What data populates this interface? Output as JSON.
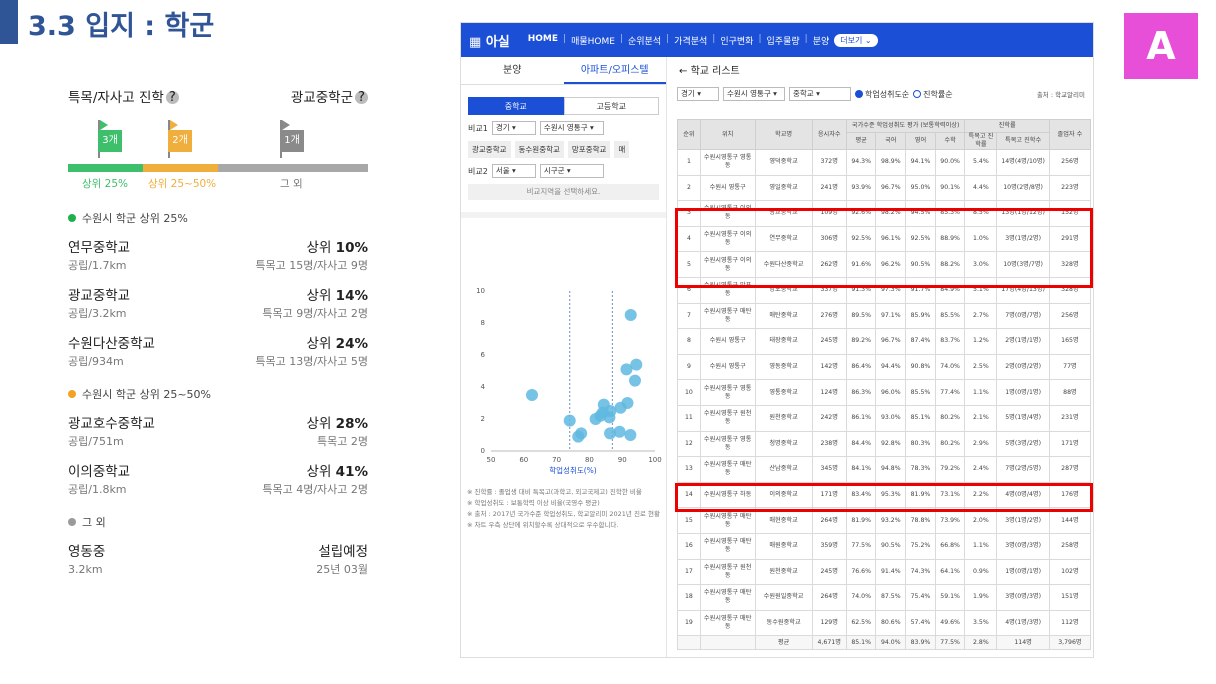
{
  "title": "3.3 입지 : 학군",
  "badge": "A",
  "left": {
    "header_left": "특목/자사고 진학",
    "header_right": "광교중학군",
    "help": "?",
    "flags": [
      {
        "label": "3개",
        "color": "#3dbf6c"
      },
      {
        "label": "2개",
        "color": "#f0ae3c"
      },
      {
        "label": "1개",
        "color": "#8a8a8a"
      }
    ],
    "bar_labels": [
      "상위 25%",
      "상위 25~50%",
      "그 외"
    ],
    "bar_colors": [
      "#3dbf6c",
      "#f0ae3c",
      "#a8a8a8"
    ],
    "sections": [
      {
        "title": "수원시 학군 상위 25%",
        "color": "#1fb04e",
        "items": [
          {
            "name": "연무중학교",
            "rank_prefix": "상위 ",
            "rank": "10%",
            "sub": "공립/1.7km",
            "detail": "특목고 15명/자사고 9명"
          },
          {
            "name": "광교중학교",
            "rank_prefix": "상위 ",
            "rank": "14%",
            "sub": "공립/3.2km",
            "detail": "특목고 9명/자사고 2명"
          },
          {
            "name": "수원다산중학교",
            "rank_prefix": "상위 ",
            "rank": "24%",
            "sub": "공립/934m",
            "detail": "특목고 13명/자사고 5명"
          }
        ]
      },
      {
        "title": "수원시 학군 상위 25~50%",
        "color": "#f0a422",
        "items": [
          {
            "name": "광교호수중학교",
            "rank_prefix": "상위 ",
            "rank": "28%",
            "sub": "공립/751m",
            "detail": "특목고 2명"
          },
          {
            "name": "이의중학교",
            "rank_prefix": "상위 ",
            "rank": "41%",
            "sub": "공립/1.8km",
            "detail": "특목고 4명/자사고 2명"
          }
        ]
      },
      {
        "title": "그 외",
        "color": "#9a9a9a",
        "items": [
          {
            "name": "영동중",
            "rank_prefix": "",
            "rank": "설립예정",
            "sub": "3.2km",
            "detail": "25년 03월"
          }
        ]
      }
    ]
  },
  "app": {
    "logo": "아실",
    "nav": [
      "HOME",
      "매물HOME",
      "순위분석",
      "가격분석",
      "인구변화",
      "입주물량",
      "분양"
    ],
    "more": "더보기",
    "tabs": [
      "분양",
      "아파트/오피스텔"
    ],
    "seg": [
      "중학교",
      "고등학교"
    ],
    "cmp1": {
      "label": "비교1",
      "a": "경기",
      "b": "수원시 영통구"
    },
    "chips": [
      "광교중학교",
      "동수원중학교",
      "망포중학교",
      "매"
    ],
    "cmp2": {
      "label": "비교2",
      "a": "서울",
      "b": "시구군"
    },
    "hint": "비교지역을 선택하세요.",
    "scatter": {
      "xlabel": "학업성취도(%)",
      "xticks": [
        "50",
        "60",
        "70",
        "80",
        "90",
        "100"
      ],
      "yticks": [
        "0",
        "2",
        "4",
        "6",
        "8",
        "10"
      ]
    },
    "notes": [
      "※ 진학률 : 졸업생 대비 특목고(과학고, 외고국제고) 진학한 비율",
      "※ 학업성취도 : 보통학력 이상 비율(국영수 평균)",
      "※ 출처 : 2017년 국가수준 학업성취도, 학교알리미 2021년 진로 현황",
      "※ 차트 우측 상단에 위치할수록 상대적으로 우수합니다."
    ],
    "list_title": "학교 리스트",
    "filter": {
      "a": "경기",
      "b": "수원시 영통구",
      "c": "중학교",
      "r1": "학업성취도순",
      "r2": "진학률순",
      "src": "출처 : 학교알리미"
    },
    "columns": [
      "순위",
      "위치",
      "학교명",
      "응시자수",
      "평균",
      "국어",
      "영어",
      "수학",
      "특목고 진학률",
      "특목고 진학수",
      "졸업자 수"
    ],
    "group1": "국가수준 학업성취도 평가 (보통학력이상)",
    "group2": "진학률",
    "rows": [
      [
        "1",
        "수원시영통구 영통동",
        "영덕중학교",
        "372명",
        "94.3%",
        "98.9%",
        "94.1%",
        "90.0%",
        "5.4%",
        "14명(4명/10명)",
        "256명"
      ],
      [
        "2",
        "수원시 영통구",
        "영일중학교",
        "241명",
        "93.9%",
        "96.7%",
        "95.0%",
        "90.1%",
        "4.4%",
        "10명(2명/8명)",
        "223명"
      ],
      [
        "3",
        "수원시영통구 이의동",
        "광교중학교",
        "109명",
        "92.6%",
        "98.2%",
        "94.5%",
        "85.3%",
        "8.5%",
        "13명(1명/12명)",
        "152명"
      ],
      [
        "4",
        "수원시영통구 이의동",
        "연무중학교",
        "306명",
        "92.5%",
        "96.1%",
        "92.5%",
        "88.9%",
        "1.0%",
        "3명(1명/2명)",
        "291명"
      ],
      [
        "5",
        "수원시영통구 이의동",
        "수원다산중학교",
        "262명",
        "91.6%",
        "96.2%",
        "90.5%",
        "88.2%",
        "3.0%",
        "10명(3명/7명)",
        "328명"
      ],
      [
        "6",
        "수원시영통구 망포동",
        "망포중학교",
        "337명",
        "91.3%",
        "97.3%",
        "91.7%",
        "84.9%",
        "5.1%",
        "17명(4명/13명)",
        "328명"
      ],
      [
        "7",
        "수원시영통구 매탄동",
        "매탄중학교",
        "276명",
        "89.5%",
        "97.1%",
        "85.9%",
        "85.5%",
        "2.7%",
        "7명(0명/7명)",
        "256명"
      ],
      [
        "8",
        "수원시 영통구",
        "태장중학교",
        "245명",
        "89.2%",
        "96.7%",
        "87.4%",
        "83.7%",
        "1.2%",
        "2명(1명/1명)",
        "165명"
      ],
      [
        "9",
        "수원시 영통구",
        "영동중학교",
        "142명",
        "86.4%",
        "94.4%",
        "90.8%",
        "74.0%",
        "2.5%",
        "2명(0명/2명)",
        "77명"
      ],
      [
        "10",
        "수원시영통구 영통동",
        "영통중학교",
        "124명",
        "86.3%",
        "96.0%",
        "85.5%",
        "77.4%",
        "1.1%",
        "1명(0명/1명)",
        "88명"
      ],
      [
        "11",
        "수원시영통구 원천동",
        "원천중학교",
        "242명",
        "86.1%",
        "93.0%",
        "85.1%",
        "80.2%",
        "2.1%",
        "5명(1명/4명)",
        "231명"
      ],
      [
        "12",
        "수원시영통구 영통동",
        "청명중학교",
        "238명",
        "84.4%",
        "92.8%",
        "80.3%",
        "80.2%",
        "2.9%",
        "5명(3명/2명)",
        "171명"
      ],
      [
        "13",
        "수원시영통구 매탄동",
        "산남중학교",
        "345명",
        "84.1%",
        "94.8%",
        "78.3%",
        "79.2%",
        "2.4%",
        "7명(2명/5명)",
        "287명"
      ],
      [
        "14",
        "수원시영통구 하동",
        "이의중학교",
        "171명",
        "83.4%",
        "95.3%",
        "81.9%",
        "73.1%",
        "2.2%",
        "4명(0명/4명)",
        "176명"
      ],
      [
        "15",
        "수원시영통구 매탄동",
        "매현중학교",
        "264명",
        "81.9%",
        "93.2%",
        "78.8%",
        "73.9%",
        "2.0%",
        "3명(1명/2명)",
        "144명"
      ],
      [
        "16",
        "수원시영통구 매탄동",
        "매원중학교",
        "359명",
        "77.5%",
        "90.5%",
        "75.2%",
        "66.8%",
        "1.1%",
        "3명(0명/3명)",
        "258명"
      ],
      [
        "17",
        "수원시영통구 원천동",
        "원천중학교",
        "245명",
        "76.6%",
        "91.4%",
        "74.3%",
        "64.1%",
        "0.9%",
        "1명(0명/1명)",
        "102명"
      ],
      [
        "18",
        "수원시영통구 매탄동",
        "수원원일중학교",
        "264명",
        "74.0%",
        "87.5%",
        "75.4%",
        "59.1%",
        "1.9%",
        "3명(0명/3명)",
        "151명"
      ],
      [
        "19",
        "수원시영통구 매탄동",
        "동수원중학교",
        "129명",
        "62.5%",
        "80.6%",
        "57.4%",
        "49.6%",
        "3.5%",
        "4명(1명/3명)",
        "112명"
      ]
    ],
    "avg": [
      "",
      "",
      "평균",
      "4,671명",
      "85.1%",
      "94.0%",
      "83.9%",
      "77.5%",
      "2.8%",
      "114명",
      "3,796명"
    ]
  }
}
